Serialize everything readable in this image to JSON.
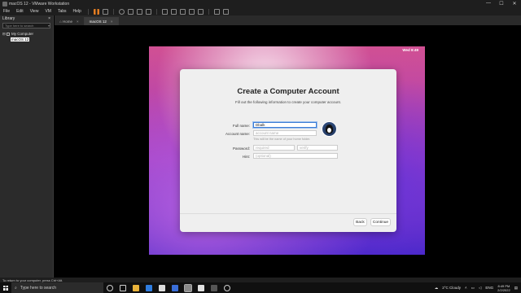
{
  "window": {
    "title": "macOS 12 - VMware Workstation",
    "controls": {
      "minimize": "—",
      "maximize": "☐",
      "close": "✕"
    }
  },
  "menubar": {
    "items": [
      "File",
      "Edit",
      "View",
      "VM",
      "Tabs",
      "Help"
    ]
  },
  "library": {
    "title": "Library",
    "close": "×",
    "search_placeholder": "Type here to search",
    "root": "My Computer",
    "vm": "macOS 12"
  },
  "tabs": [
    {
      "label": "Home",
      "close": "×"
    },
    {
      "label": "macOS 12",
      "close": "×"
    }
  ],
  "guest": {
    "clock": "Wed 8:49",
    "dialog": {
      "title": "Create a Computer Account",
      "subtitle": "Fill out the following information to create your computer account.",
      "full_name_label": "Full name:",
      "full_name_value": "Dbalk",
      "account_name_label": "Account name:",
      "account_name_placeholder": "account name",
      "account_hint": "This will be the name of your home folder.",
      "password_label": "Password:",
      "password_placeholder": "required",
      "verify_placeholder": "verify",
      "hint_label": "Hint:",
      "hint_placeholder": "(optional)",
      "back_button": "Back",
      "continue_button": "Continue"
    }
  },
  "statusbar": {
    "text": "To return to your computer, press Ctrl+Alt."
  },
  "taskbar": {
    "search_placeholder": "Type here to search",
    "weather": "2°C  Cloudy",
    "language": "ENG",
    "time": "8:49 PM",
    "date": "2/2/2022"
  },
  "colors": {
    "accent": "#3a7bd5",
    "pause": "#e67e22",
    "taskbar": "#101010"
  }
}
